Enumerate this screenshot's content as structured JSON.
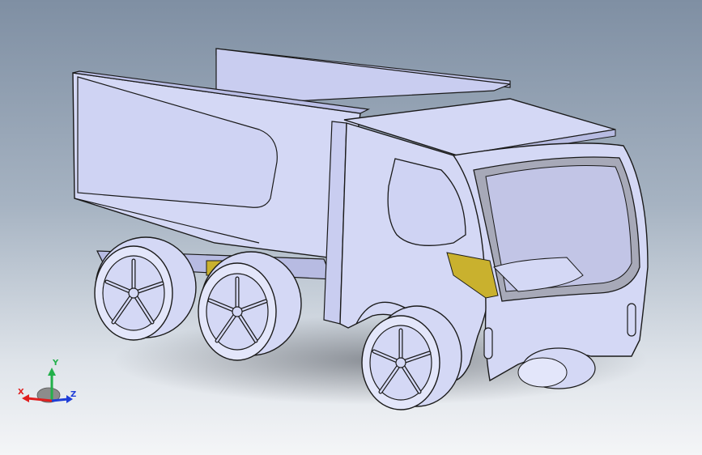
{
  "viewport": {
    "background_top": "#7f8fa3",
    "background_bottom": "#f4f5f7"
  },
  "model": {
    "body_color": "#d4d8f5",
    "shade_color": "#b7bbe2",
    "accent_color": "#c9b12e",
    "edge_color": "#1a1a1a"
  },
  "triad": {
    "x_label": "X",
    "y_label": "Y",
    "z_label": "Z",
    "x_color": "#e01e1e",
    "y_color": "#22b04a",
    "z_color": "#1f3ed8",
    "icon": "view-orientation-triad-icon"
  }
}
